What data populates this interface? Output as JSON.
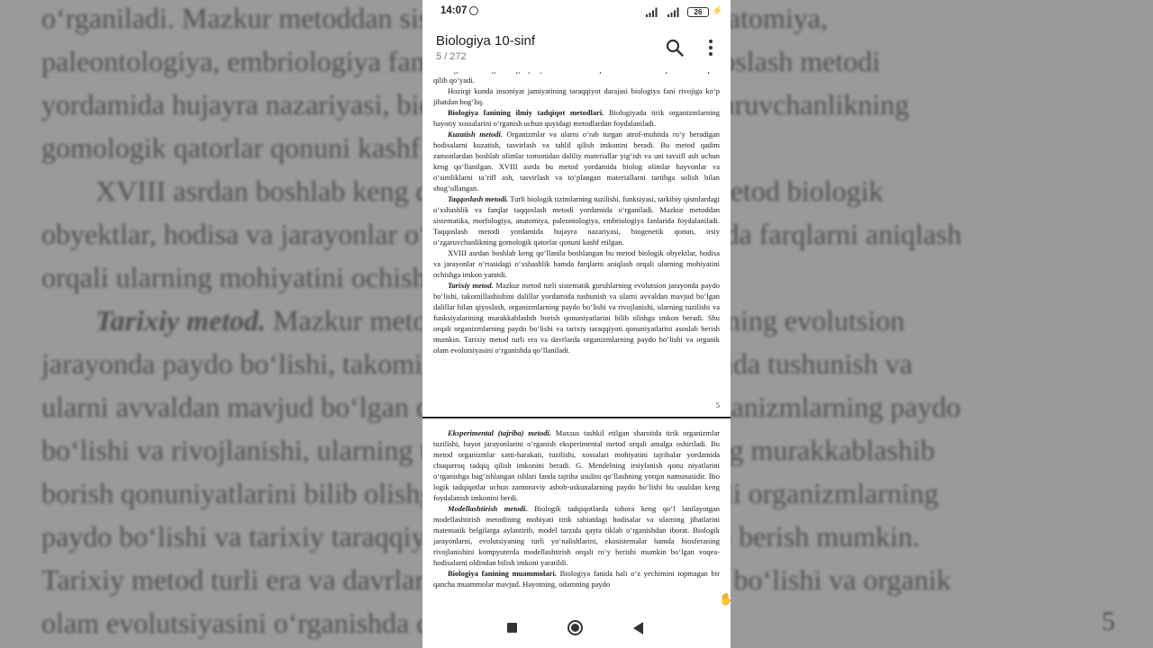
{
  "status_bar": {
    "time": "14:07",
    "battery": "26"
  },
  "app_bar": {
    "title": "Biologiya 10-sinf",
    "page_counter": "5 / 272"
  },
  "page1": {
    "paragraphs": [
      {
        "head": "",
        "text": "organizmlardagi biologik jarayonlarni ishlab chiqarish korxonalarida qo‘llashni maqsad qilib qo‘yadi."
      },
      {
        "head": "",
        "text": "Hozirgi kunda insoniyat jamiyatining taraqqiyot darajasi biologiya fani rivojiga ko‘p jihatdan bog‘liq."
      },
      {
        "head": "Biologiya fanining ilmiy tadqiqot metodlari.",
        "text": " Biologiyada tirik organizmlarning hayotiy xossalarini o‘rganish uchun quyidagi metodlardan foydalaniladi."
      },
      {
        "head": "Kuzatish metodi.",
        "text": " Organizmlar va ularni o‘rab turgan atrof-muhitda ro‘y beradigan hodisalarni kuzatish, tasvirlash va tahlil qilish imkonini beradi. Bu metod qadim zamonlardan boshlab olimlar tomonidan daliliy materiallar yig‘ish va uni tavsifl ash uchun keng qo‘llanilgan. XVIII asrda bu metod yordamida biolog olimlar hayvonlar va o‘simliklarni ta’rifl ash, tasvirlash va to‘plangan materiallarni tartibga solish bilan shug‘ullangan."
      },
      {
        "head": "Taqqoslash metodi.",
        "text": " Turli biologik tizimlarning tuzilishi, funksiyasi, tarkibiy qismlardagi o‘xshashlik va farqlar taqqoslash metodi yordamida o‘rganiladi. Mazkur metoddan sistematika, morfologiya, anatomiya, paleontologiya, embriologiya fanlarida foydalaniladi. Taqqoslash metodi yordamida hujayra nazariyasi, biogenetik qonun, irsiy o‘zgaruvchanlikning gomologik qatorlar qonuni kashf etilgan."
      },
      {
        "head": "",
        "text": "XVIII asrdan boshlab keng qo‘llanila boshlangan bu metod biologik obyektlar, hodisa va jarayonlar o‘rtasidagi o‘xshashlik hamda farqlarni aniqlash orqali ularning mohiyatini ochishga imkon yaratdi."
      },
      {
        "head": "Tarixiy metod.",
        "text": " Mazkur metod turli sistematik guruhlarning evolutsion jarayonda paydo bo‘lishi, takomillashishini dalillar yordamida tushunish va ularni avvaldan mavjud bo‘lgan dalillar bilan qiyoslash, organizmlarning paydo bo‘lishi va rivojlanishi, ularning tuzilishi va funksiyalarining murakkablashib borish qonuniyatlarini bilib olishga imkon beradi. Shu orqali organizmlarning paydo bo‘lishi va tarixiy taraqqiyoti qonuniyatlarini asoslab berish mumkin. Tarixiy metod turli era va davrlarda organizmlarning paydo bo‘lishi va organik olam evolutsiyasini o‘rganishda qo‘llaniladi."
      }
    ],
    "page_number": "5"
  },
  "page2": {
    "paragraphs": [
      {
        "head": "Eksperimental (tajriba) metodi.",
        "text": " Maxsus tashkil etilgan sharoitda tirik organizmlar tuzilishi, hayot jarayonlarini o‘rganish eksperimental metod orqali amalga oshiriladi. Bu metod organizmlar xatti-harakati, tuzilishi, xossalari mohiyatini tajribalar yordamida chuqurroq tadqiq qilish imkonini beradi. G. Mendelning irsiylanish qonu niyatlarini o‘rganishga bag‘ishlangan ishlari fanda tajriba usulini qo‘llashning yorqin namunasidir. Bio logik tadqiqotlar uchun zamonaviy asbob-uskunalarning paydo bo‘lishi bu usuldan keng foydalanish imkonini berdi."
      },
      {
        "head": "Modellashtirish metodi.",
        "text": " Biologik tadqiqotlarda tobora keng qo‘l lanilayotgan modellashtirish metodining mohiyati tirik tabiatdagi hodisalar va ularning jihatlarini matematik belgilarga aylantirib, model tarzida qayta tiklab o‘rganishdan iborat. Biologik jarayonlarni, evolutsiyaning turli yo‘nalishlarini, ekosistemalar hamda biosferaning rivojlanishini kompyuterda modellashtirish orqali ro‘y berishi mumkin bo‘lgan voqea-hodisalarni oldindan bilish imkoni yaratildi."
      },
      {
        "head": "Biologiya fanining muammolari.",
        "text": " Biologiya fanida hali o‘z yechimini topmagan bir qancha muammolar mavjud. Hayotning, odamning paydo"
      }
    ]
  },
  "background": {
    "lines": [
      "o‘rganiladi. Mazkur metoddan sistematika, morfologiya, anatomiya,",
      "paleontologiya, embriologiya fanlarida foydalaniladi. Taqqoslash metodi",
      "yordamida hujayra nazariyasi, biogenetik qonun, irsiy o‘zgaruvchanlikning",
      "gomologik qatorlar qonuni kashf etilgan.",
      "XVIII asrdan boshlab keng qo‘llanila boshlangan bu metod biologik",
      "obyektlar, hodisa va jarayonlar o‘rtasidagi o‘xshashlik hamda farqlarni aniqlash",
      "orqali ularning mohiyatini ochishga imkon yaratdi.",
      "Tarixiy metod. Mazkur metod turli sistematik guruhlarning evolutsion",
      "jarayonda paydo bo‘lishi, takomillashishini dalillar yordamida tushunish va",
      "ularni avvaldan mavjud bo‘lgan dalillar bilan qiyoslash, organizmlarning paydo",
      "bo‘lishi va rivojlanishi, ularning tuzilishi va funksiyalarining murakkablashib",
      "borish qonuniyatlarini bilib olishga imkon beradi. Shu orqali organizmlarning",
      "paydo bo‘lishi va tarixiy taraqqiyoti qonuniyatlarini asoslab berish mumkin.",
      "Tarixiy metod turli era va davrlarda organizmlarning paydo bo‘lishi va organik",
      "olam evolutsiyasini o‘rganishda qo‘llaniladi."
    ],
    "page_number": "5"
  },
  "icons": {
    "search": "search-icon",
    "menu": "more-vert-icon",
    "alarm": "alarm-icon",
    "battery": "battery-icon"
  }
}
